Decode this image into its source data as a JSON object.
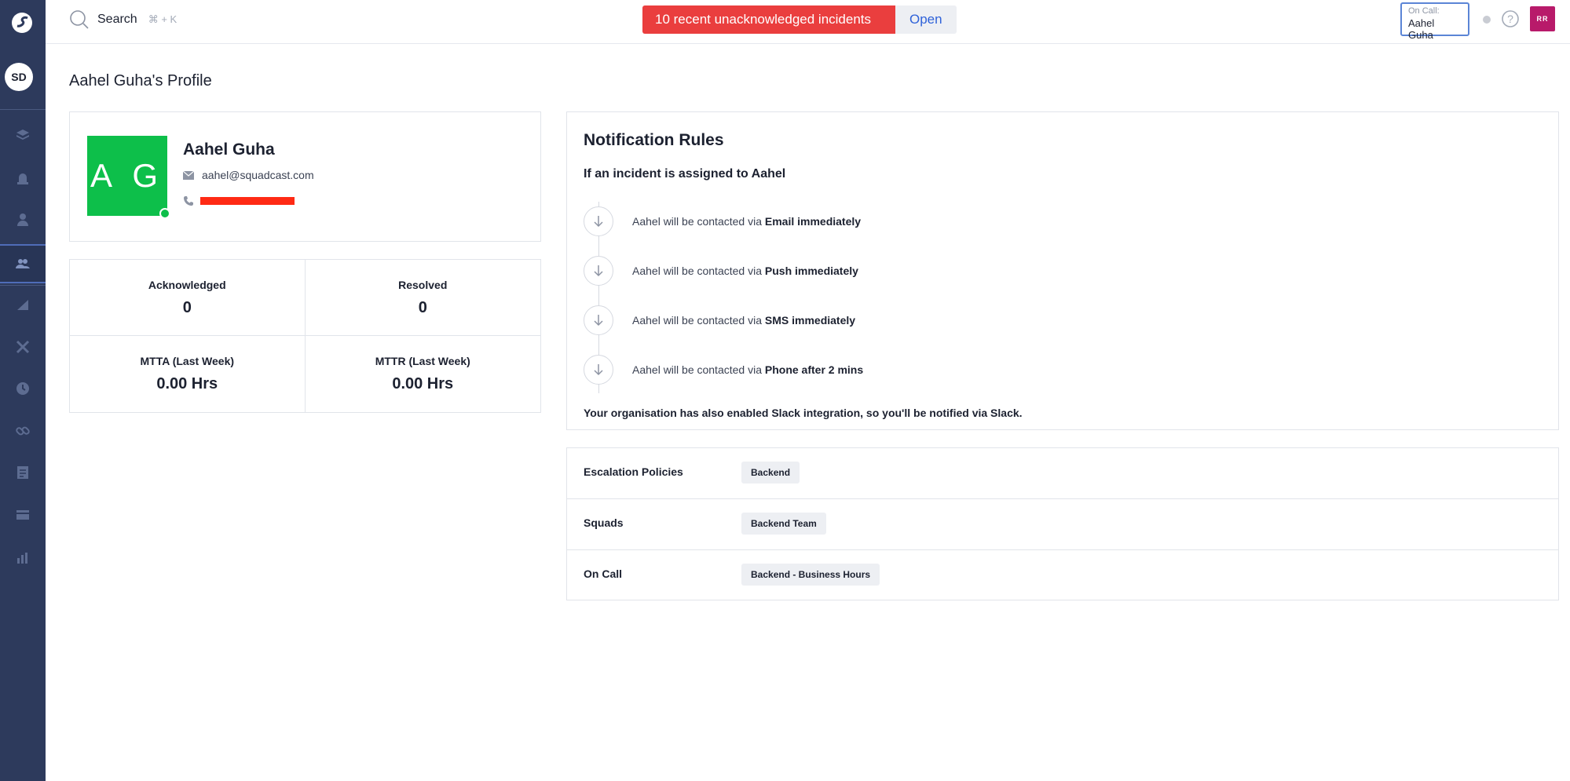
{
  "sidebar": {
    "org_initials": "SD",
    "items": [
      {
        "icon": "layers-icon"
      },
      {
        "icon": "alarm-icon"
      },
      {
        "icon": "user-icon"
      },
      {
        "icon": "team-icon"
      },
      {
        "icon": "analytics-icon"
      },
      {
        "icon": "tools-icon"
      },
      {
        "icon": "clock-icon"
      },
      {
        "icon": "link-icon"
      },
      {
        "icon": "checklist-icon"
      },
      {
        "icon": "card-icon"
      },
      {
        "icon": "bar-chart-icon"
      }
    ]
  },
  "topbar": {
    "search_label": "Search",
    "search_shortcut": "⌘ + K",
    "incident_message": "10 recent unacknowledged incidents",
    "incident_action": "Open",
    "oncall_label": "On Call:",
    "oncall_name": "Aahel Guha",
    "user_initials": "RR"
  },
  "page": {
    "title": "Aahel Guha's Profile"
  },
  "profile": {
    "initials": "A G",
    "name": "Aahel Guha",
    "email": "aahel@squadcast.com"
  },
  "stats": [
    {
      "label": "Acknowledged",
      "value": "0"
    },
    {
      "label": "Resolved",
      "value": "0"
    },
    {
      "label": "MTTA (Last Week)",
      "value": "0.00 Hrs"
    },
    {
      "label": "MTTR (Last Week)",
      "value": "0.00 Hrs"
    }
  ],
  "notification_rules": {
    "title": "Notification Rules",
    "subtitle": "If an incident is assigned to Aahel",
    "rules": [
      {
        "prefix": "Aahel will be contacted via",
        "method": "Email immediately"
      },
      {
        "prefix": "Aahel will be contacted via",
        "method": "Push immediately"
      },
      {
        "prefix": "Aahel will be contacted via",
        "method": "SMS immediately"
      },
      {
        "prefix": "Aahel will be contacted via",
        "method": "Phone after 2 mins"
      }
    ],
    "slack_note": "Your organisation has also enabled Slack integration, so you'll be notified via Slack."
  },
  "info_rows": [
    {
      "label": "Escalation Policies",
      "tag": "Backend"
    },
    {
      "label": "Squads",
      "tag": "Backend Team"
    },
    {
      "label": "On Call",
      "tag": "Backend - Business Hours"
    }
  ],
  "colors": {
    "sidebar": "#2d3a5c",
    "incident_red": "#ea3e3e",
    "avatar_green": "#0dbf4a",
    "user_avatar": "#b81a6a",
    "link_blue": "#2f62d9"
  }
}
